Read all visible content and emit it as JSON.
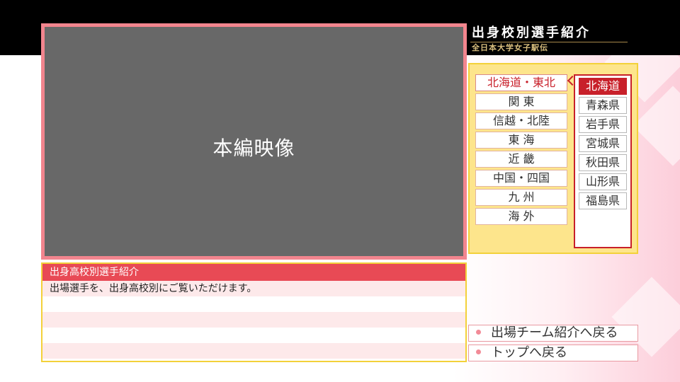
{
  "header": {
    "title": "出身校別選手紹介",
    "subtitle": "全日本大学女子駅伝"
  },
  "video": {
    "label": "本編映像"
  },
  "info": {
    "title": "出身高校別選手紹介",
    "description": "出場選手を、出身高校別にご覧いただけます。"
  },
  "regions": [
    {
      "label": "北海道・東北",
      "active": true
    },
    {
      "label": "関 東",
      "active": false
    },
    {
      "label": "信越・北陸",
      "active": false
    },
    {
      "label": "東 海",
      "active": false
    },
    {
      "label": "近 畿",
      "active": false
    },
    {
      "label": "中国・四国",
      "active": false
    },
    {
      "label": "九 州",
      "active": false
    },
    {
      "label": "海 外",
      "active": false
    }
  ],
  "prefectures": [
    {
      "label": "北海道",
      "active": true
    },
    {
      "label": "青森県",
      "active": false
    },
    {
      "label": "岩手県",
      "active": false
    },
    {
      "label": "宮城県",
      "active": false
    },
    {
      "label": "秋田県",
      "active": false
    },
    {
      "label": "山形県",
      "active": false
    },
    {
      "label": "福島県",
      "active": false
    }
  ],
  "nav": {
    "back_team_label": "出場チーム紹介へ戻る",
    "back_top_label": "トップへ戻る"
  },
  "colors": {
    "accent_red": "#c8202a",
    "title_red": "#e84a55",
    "frame_pink": "#f2858e",
    "panel_yellow": "#fde58c",
    "gold": "#d9bf7e"
  },
  "icons": [
    "chevron-left-icon",
    "bullet-dot-icon"
  ]
}
